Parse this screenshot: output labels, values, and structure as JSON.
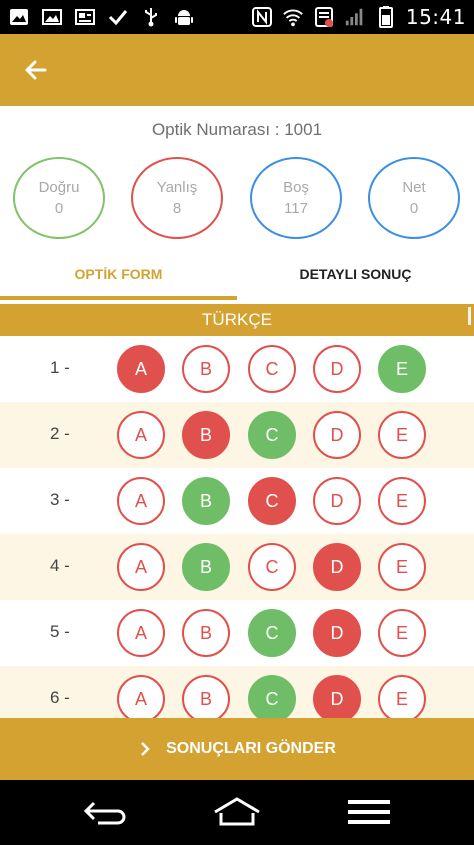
{
  "status_bar": {
    "time": "15:41",
    "left_icons": [
      "image-icon",
      "gallery-icon",
      "card-icon",
      "check-icon",
      "usb-icon",
      "android-icon"
    ],
    "right_icons": [
      "nfc-icon",
      "wifi-icon",
      "data-saver-icon",
      "signal-icon",
      "battery-icon"
    ]
  },
  "header": {
    "optik_no": "Optik Numarası : 1001",
    "stats": [
      {
        "label": "Doğru",
        "value": "0",
        "color": "#82c268"
      },
      {
        "label": "Yanlış",
        "value": "8",
        "color": "#e0504c"
      },
      {
        "label": "Boş",
        "value": "117",
        "color": "#3b8fe3"
      },
      {
        "label": "Net",
        "value": "0",
        "color": "#3b8fe3"
      }
    ]
  },
  "tabs": {
    "optik": "OPTİK FORM",
    "detay": "DETAYLI SONUÇ",
    "active": "optik"
  },
  "section": {
    "title": "TÜRKÇE"
  },
  "questions": [
    {
      "num": "1 -",
      "options": [
        "A",
        "B",
        "C",
        "D",
        "E"
      ],
      "states": [
        "red",
        "empty",
        "empty",
        "empty",
        "green"
      ]
    },
    {
      "num": "2 -",
      "options": [
        "A",
        "B",
        "C",
        "D",
        "E"
      ],
      "states": [
        "empty",
        "red",
        "green",
        "empty",
        "empty"
      ]
    },
    {
      "num": "3 -",
      "options": [
        "A",
        "B",
        "C",
        "D",
        "E"
      ],
      "states": [
        "empty",
        "green",
        "red",
        "empty",
        "empty"
      ]
    },
    {
      "num": "4 -",
      "options": [
        "A",
        "B",
        "C",
        "D",
        "E"
      ],
      "states": [
        "empty",
        "green",
        "empty",
        "red",
        "empty"
      ]
    },
    {
      "num": "5 -",
      "options": [
        "A",
        "B",
        "C",
        "D",
        "E"
      ],
      "states": [
        "empty",
        "empty",
        "green",
        "red",
        "empty"
      ]
    },
    {
      "num": "6 -",
      "options": [
        "A",
        "B",
        "C",
        "D",
        "E"
      ],
      "states": [
        "empty",
        "empty",
        "green",
        "red",
        "empty"
      ]
    }
  ],
  "send_button": {
    "label": "SONUÇLARI GÖNDER"
  },
  "colors": {
    "accent": "#d4a231",
    "wrong": "#e0504c",
    "correct": "#6fbe67",
    "empty_stat": "#3b8fe3"
  }
}
